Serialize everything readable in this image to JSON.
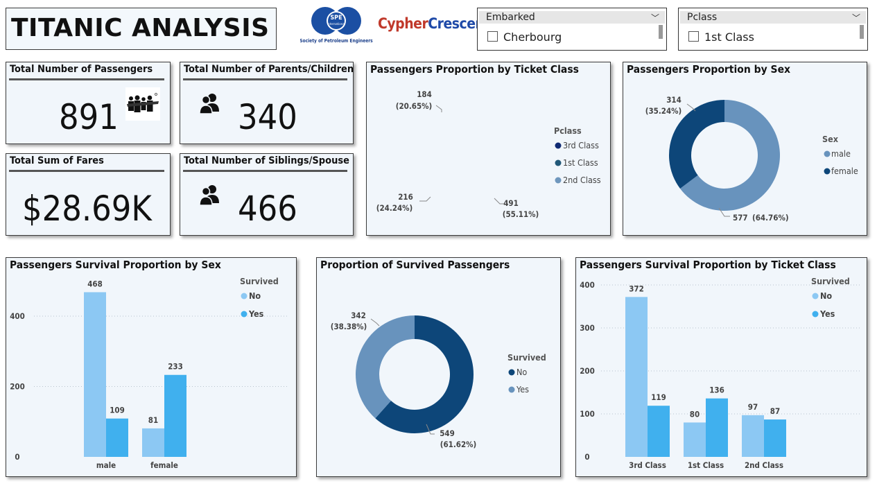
{
  "header": {
    "title": "TITANIC ANALYSIS",
    "spe_logo_text": "SPE",
    "spe_logo_sub": "International",
    "spe_caption": "Society of Petroleum Engineers",
    "cc_logo_part1": "Cypher",
    "cc_logo_part2": "Crescent"
  },
  "slicers": {
    "embarked": {
      "label": "Embarked",
      "option": "Cherbourg",
      "checked": false
    },
    "pclass": {
      "label": "Pclass",
      "option": "1st Class",
      "checked": false
    }
  },
  "cards": {
    "passengers": {
      "title": "Total Number of Passengers",
      "value": "891",
      "icon": "people-group-icon"
    },
    "parents": {
      "title": "Total Number of Parents/Children",
      "value": "340",
      "icon": "users-icon"
    },
    "fares": {
      "title": "Total Sum of Fares",
      "value": "$28.69K"
    },
    "siblings": {
      "title": "Total Number of Siblings/Spouse",
      "value": "466",
      "icon": "users-icon"
    }
  },
  "colors": {
    "dark_navy": "#0f2a73",
    "teal_dark": "#215878",
    "steel": "#6f97bd",
    "light_blue": "#8cc8f3",
    "bright_blue": "#40b0ee",
    "navy_sex": "#0d4679",
    "steel_sex": "#6893bd"
  },
  "chart_data": [
    {
      "id": "pclass_pie",
      "type": "pie",
      "title": "Passengers Proportion by Ticket Class",
      "legend_title": "Pclass",
      "slices": [
        {
          "label": "3rd Class",
          "value": 491,
          "pct_label": "(55.11%)",
          "color": "#0f2a73"
        },
        {
          "label": "1st Class",
          "value": 216,
          "pct_label": "(24.24%)",
          "color": "#215878"
        },
        {
          "label": "2nd Class",
          "value": 184,
          "pct_label": "(20.65%)",
          "color": "#6f97bd"
        }
      ]
    },
    {
      "id": "sex_pie",
      "type": "pie",
      "title": "Passengers Proportion by Sex",
      "legend_title": "Sex",
      "slices": [
        {
          "label": "male",
          "value": 577,
          "pct_label": "(64.76%)",
          "color": "#6893bd"
        },
        {
          "label": "female",
          "value": 314,
          "pct_label": "(35.24%)",
          "color": "#0d4679"
        }
      ]
    },
    {
      "id": "survival_sex",
      "type": "bar",
      "title": "Passengers Survival Proportion by Sex",
      "legend_title": "Survived",
      "categories": [
        "male",
        "female"
      ],
      "series": [
        {
          "name": "No",
          "values": [
            468,
            81
          ],
          "color": "#8cc8f3"
        },
        {
          "name": "Yes",
          "values": [
            109,
            233
          ],
          "color": "#40b0ee"
        }
      ],
      "yticks": [
        0,
        200,
        400
      ],
      "ylim": [
        0,
        530
      ]
    },
    {
      "id": "survived_pie",
      "type": "pie",
      "title": "Proportion of Survived Passengers",
      "legend_title": "Survived",
      "slices": [
        {
          "label": "No",
          "value": 549,
          "pct_label": "(61.62%)",
          "color": "#0d4679"
        },
        {
          "label": "Yes",
          "value": 342,
          "pct_label": "(38.38%)",
          "color": "#6893bd"
        }
      ]
    },
    {
      "id": "survival_class",
      "type": "bar",
      "title": "Passengers Survival Proportion by Ticket Class",
      "legend_title": "Survived",
      "categories": [
        "3rd Class",
        "1st Class",
        "2nd Class"
      ],
      "series": [
        {
          "name": "No",
          "values": [
            372,
            80,
            97
          ],
          "color": "#8cc8f3"
        },
        {
          "name": "Yes",
          "values": [
            119,
            136,
            87
          ],
          "color": "#40b0ee"
        }
      ],
      "yticks": [
        0,
        100,
        200,
        300,
        400
      ],
      "ylim": [
        0,
        400
      ]
    }
  ]
}
